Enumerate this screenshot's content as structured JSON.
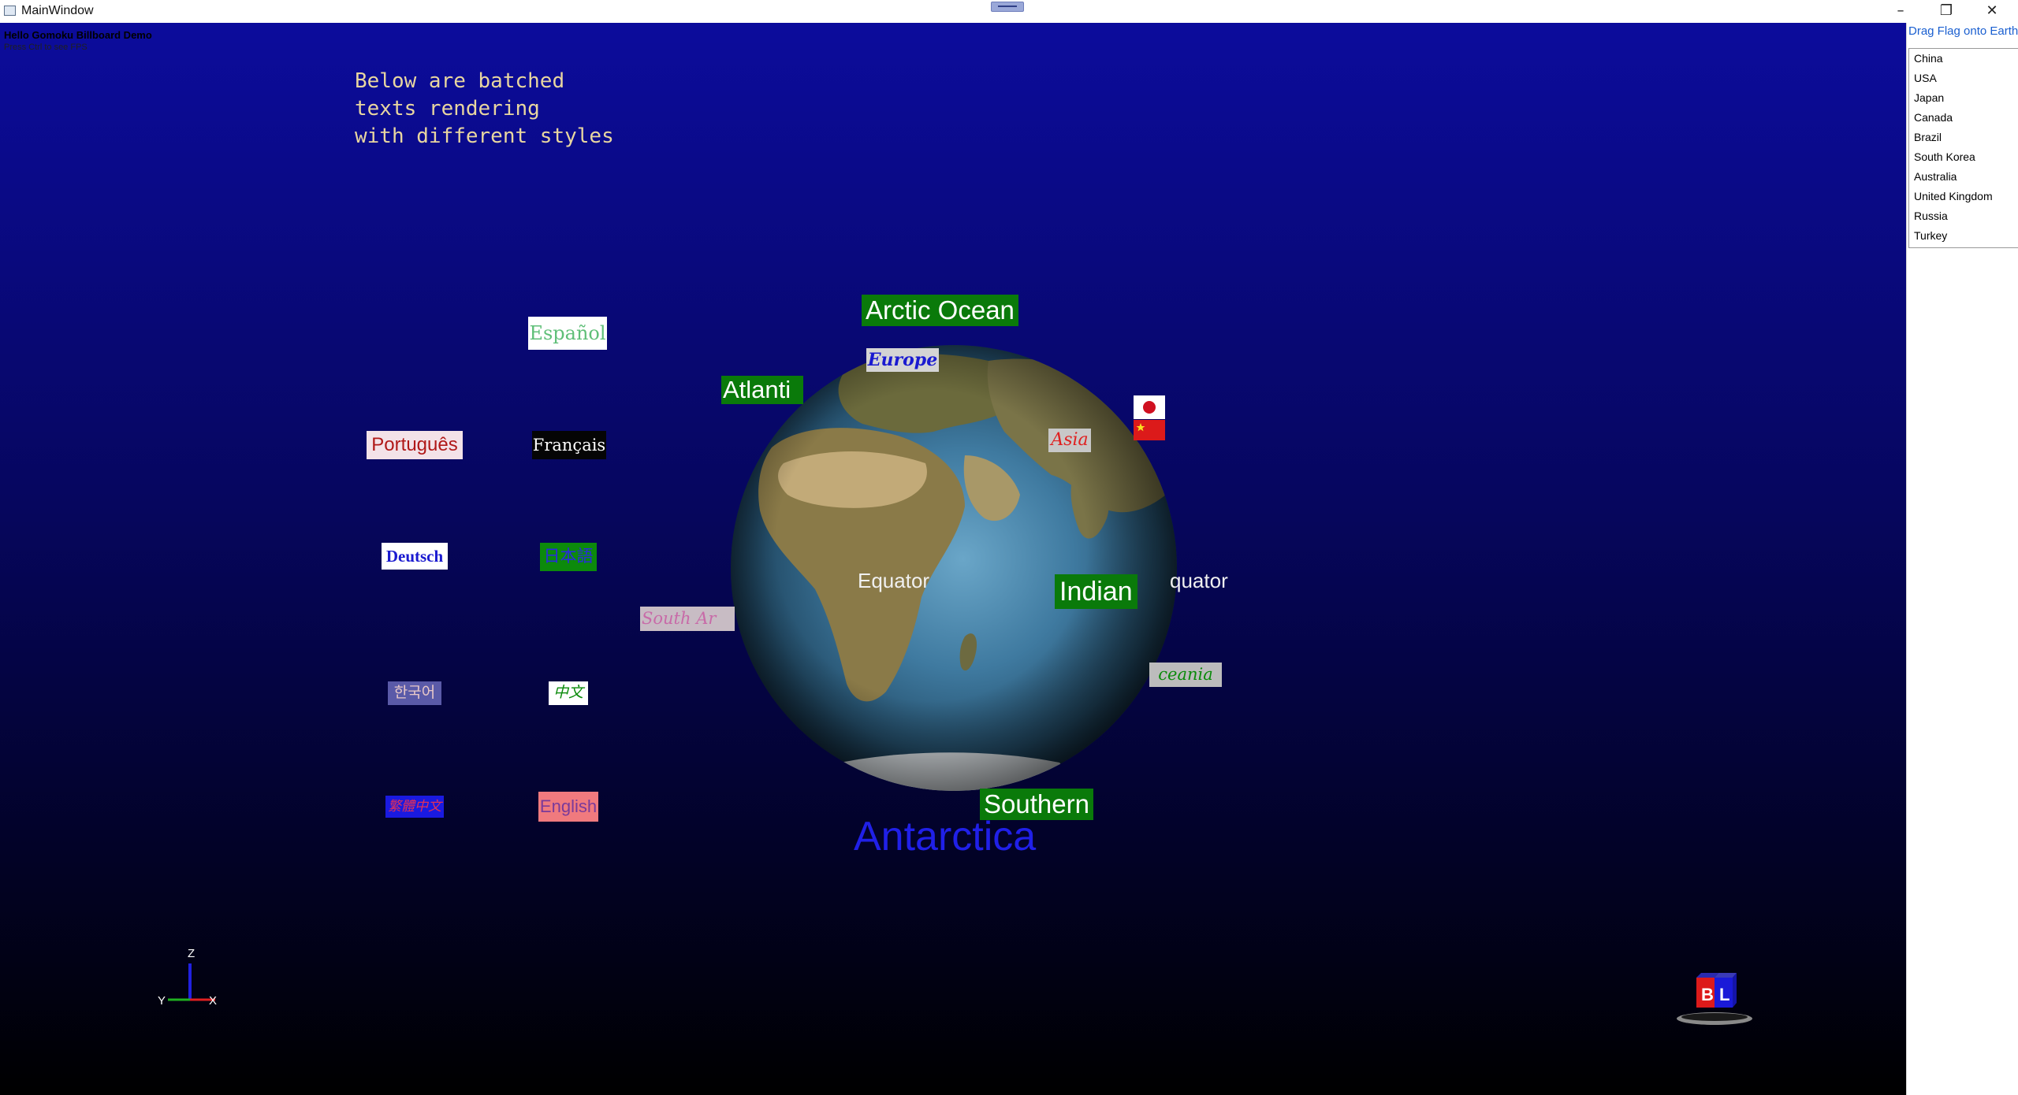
{
  "window": {
    "title": "MainWindow",
    "minimize_glyph": "–",
    "maximize_glyph": "❐",
    "close_glyph": "✕"
  },
  "viewport": {
    "header_line1": "Hello Gomoku Billboard Demo",
    "header_line2": "Press Ctrl to see FPS",
    "batched_caption": "Below are batched\ntexts rendering\nwith different styles"
  },
  "globe_labels": {
    "arctic": "Arctic Ocean",
    "europe": "Europe",
    "atlantic": "Atlanti",
    "asia": "Asia",
    "equator_center": "Equator",
    "equator_right": "quator",
    "indian": "Indian",
    "south_america": "South Ar",
    "oceania": "ceania",
    "southern": "Southern",
    "antarctica": "Antarctica"
  },
  "languages": [
    {
      "id": "espanol",
      "text": "Español"
    },
    {
      "id": "portugues",
      "text": "Português"
    },
    {
      "id": "francais",
      "text": "Français"
    },
    {
      "id": "deutsch",
      "text": "Deutsch"
    },
    {
      "id": "japanese",
      "text": "日本語"
    },
    {
      "id": "korean",
      "text": "한국어"
    },
    {
      "id": "chinese",
      "text": "中文"
    },
    {
      "id": "traditional-chinese",
      "text": "繁體中文"
    },
    {
      "id": "english",
      "text": "English"
    }
  ],
  "axis": {
    "z": "Z",
    "y": "Y",
    "x": "X"
  },
  "view_cube": {
    "face1": "B",
    "face2": "L"
  },
  "side_panel": {
    "title": "Drag Flag onto Earth",
    "countries": [
      "China",
      "USA",
      "Japan",
      "Canada",
      "Brazil",
      "South Korea",
      "Australia",
      "United Kingdom",
      "Russia",
      "Turkey"
    ]
  },
  "colors": {
    "label_green": "#0a7a0a",
    "antarctica_blue": "#2020e8",
    "link_blue": "#1a5fd0"
  },
  "icons": [
    "app-icon",
    "minimize-icon",
    "maximize-icon",
    "close-icon",
    "japan-flag-icon",
    "china-flag-icon",
    "axis-gizmo-icon",
    "view-cube-icon"
  ]
}
